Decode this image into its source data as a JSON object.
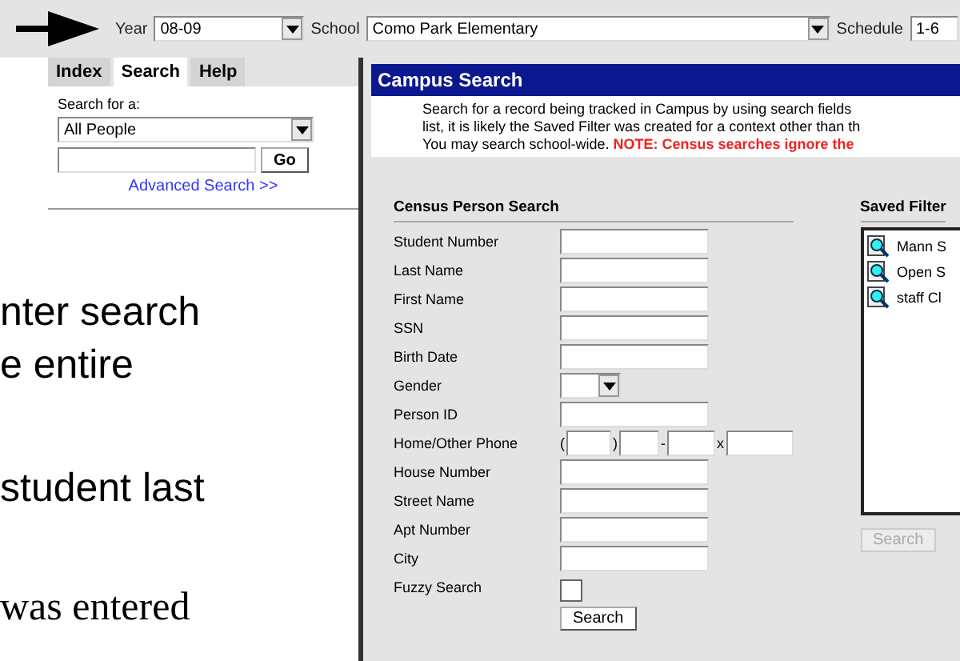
{
  "top_bar": {
    "year": {
      "label": "Year",
      "value": "08-09"
    },
    "school": {
      "label": "School",
      "value": "Como Park Elementary"
    },
    "schedule": {
      "label": "Schedule",
      "value": "1-6"
    }
  },
  "tabs": [
    {
      "label": "Index",
      "selected": false
    },
    {
      "label": "Search",
      "selected": true
    },
    {
      "label": "Help",
      "selected": false
    }
  ],
  "sidebar": {
    "search_for_label": "Search for a:",
    "search_type": "All People",
    "go_button": "Go",
    "advanced_link": "Advanced Search >>"
  },
  "slide_text": [
    "nter search",
    "e entire",
    "student last",
    "was entered"
  ],
  "campus_search": {
    "title": "Campus Search",
    "description": [
      "Search for a record being tracked in Campus by using search fields",
      "list, it is likely the Saved Filter was created for a context other than th",
      "You may search school-wide. "
    ],
    "note": "NOTE: Census searches ignore the"
  },
  "census_search": {
    "title": "Census Person Search",
    "fields": [
      {
        "label": "Student Number",
        "kind": "text"
      },
      {
        "label": "Last Name",
        "kind": "text"
      },
      {
        "label": "First Name",
        "kind": "text"
      },
      {
        "label": "SSN",
        "kind": "text"
      },
      {
        "label": "Birth Date",
        "kind": "text"
      },
      {
        "label": "Gender",
        "kind": "select"
      },
      {
        "label": "Person ID",
        "kind": "text"
      },
      {
        "label": "Home/Other Phone",
        "kind": "phone",
        "separators": [
          "(",
          ")",
          "-",
          "x"
        ]
      },
      {
        "label": "House Number",
        "kind": "text"
      },
      {
        "label": "Street Name",
        "kind": "text"
      },
      {
        "label": "Apt Number",
        "kind": "text"
      },
      {
        "label": "City",
        "kind": "text"
      },
      {
        "label": "Fuzzy Search",
        "kind": "checkbox",
        "checked": false
      }
    ],
    "search_button": "Search"
  },
  "saved_filters": {
    "title": "Saved Filter",
    "items": [
      "Mann S",
      "Open S",
      "staff Cl"
    ],
    "search_button": "Search",
    "search_disabled": true
  }
}
